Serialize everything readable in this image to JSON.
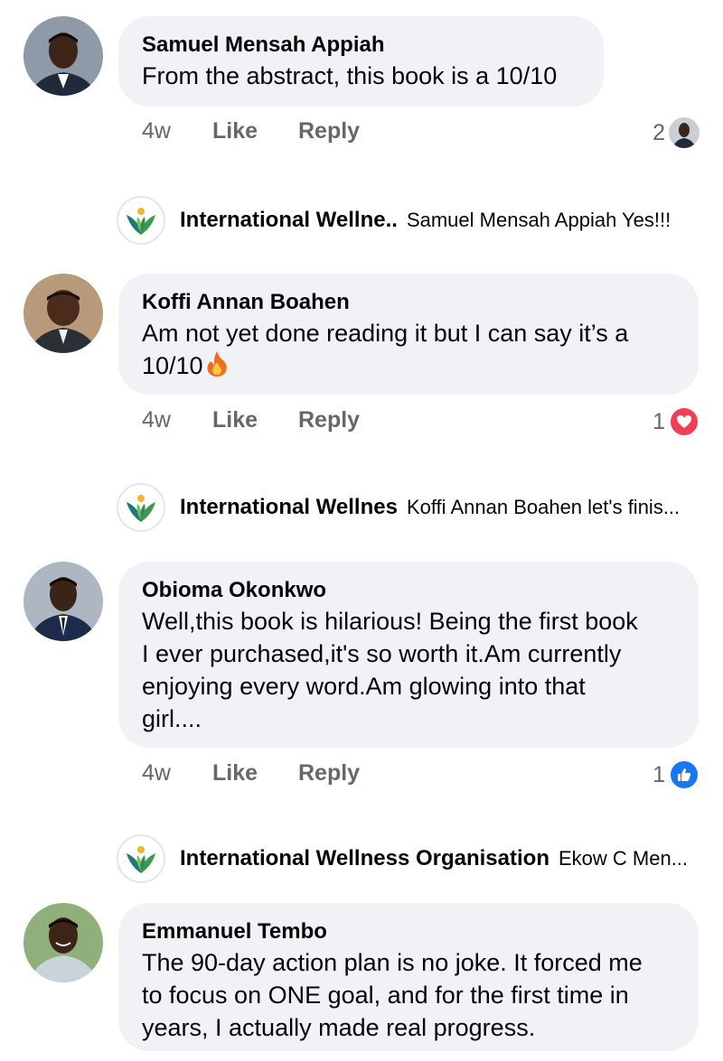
{
  "comments": [
    {
      "author": "Samuel Mensah Appiah",
      "lines": [
        "From the abstract, this book is a 10/10"
      ],
      "time": "4w",
      "like_label": "Like",
      "reply_label": "Reply",
      "reaction_count": "2",
      "reaction": "reactor-avatar",
      "reply": {
        "org": "International Wellne..",
        "snippet": "Samuel Mensah Appiah Yes!!!"
      }
    },
    {
      "author": "Koffi Annan Boahen",
      "lines": [
        "Am not yet done reading it but I can say it’s a",
        "10/10"
      ],
      "emoji": "fire-icon",
      "time": "4w",
      "like_label": "Like",
      "reply_label": "Reply",
      "reaction_count": "1",
      "reaction": "love-icon",
      "reply": {
        "org": "International Wellnes",
        "snippet": "Koffi Annan Boahen let's finis..."
      }
    },
    {
      "author": "Obioma Okonkwo",
      "lines": [
        "Well,this book is hilarious! Being the first book",
        "I ever purchased,it's so worth it.Am currently",
        "enjoying every word.Am glowing into that",
        "girl...."
      ],
      "time": "4w",
      "like_label": "Like",
      "reply_label": "Reply",
      "reaction_count": "1",
      "reaction": "like-icon",
      "reply": {
        "org": "International Wellness Organisation",
        "snippet": "Ekow C Men..."
      }
    },
    {
      "author": "Emmanuel Tembo",
      "lines": [
        "The 90-day action plan is no joke. It forced me",
        "to focus on ONE goal, and for the first time in",
        "years, I actually made real progress."
      ]
    }
  ],
  "colors": {
    "bubble": "#f0f2f5",
    "muted": "#65676b",
    "love": "#f33e58",
    "like": "#1877f2",
    "logo_green": "#3a9b4a",
    "logo_teal": "#1c7a7a",
    "logo_yellow": "#f2b52c"
  }
}
